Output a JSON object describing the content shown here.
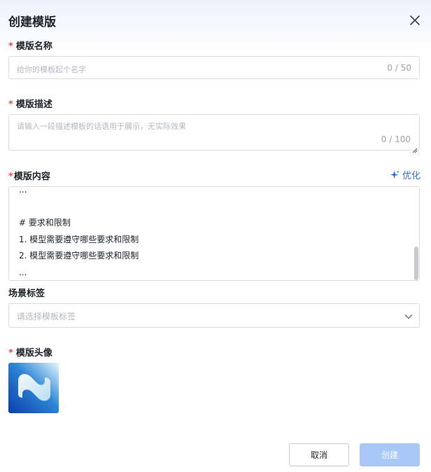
{
  "dialog": {
    "title": "创建模版"
  },
  "fields": {
    "name": {
      "label": "模版名称",
      "required_mark": "*",
      "placeholder": "给你的模板起个名字",
      "counter": "0 / 50"
    },
    "description": {
      "label": "模版描述",
      "required_mark": "*",
      "placeholder": "请输入一段描述模板的话语用于展示，无实际效果",
      "counter": "0 / 100"
    },
    "content": {
      "label": "模版内容",
      "required_mark": "*",
      "optimize_label": "优化",
      "lines": [
        "...",
        "",
        "# 要求和限制",
        "1. 模型需要遵守哪些要求和限制",
        "2. 模型需要遵守哪些要求和限制",
        "..."
      ]
    },
    "scene_tag": {
      "label": "场景标签",
      "placeholder": "请选择模板标签"
    },
    "avatar": {
      "label": "模版头像",
      "required_mark": "*"
    }
  },
  "footer": {
    "cancel_label": "取消",
    "create_label": "创建"
  },
  "colors": {
    "required": "#f54a45",
    "accent": "#2f6ee6",
    "create_disabled": "#a9c7f8"
  },
  "icons": {
    "close": "close-icon",
    "optimize": "sparkle-icon",
    "dropdown": "chevron-down-icon"
  }
}
